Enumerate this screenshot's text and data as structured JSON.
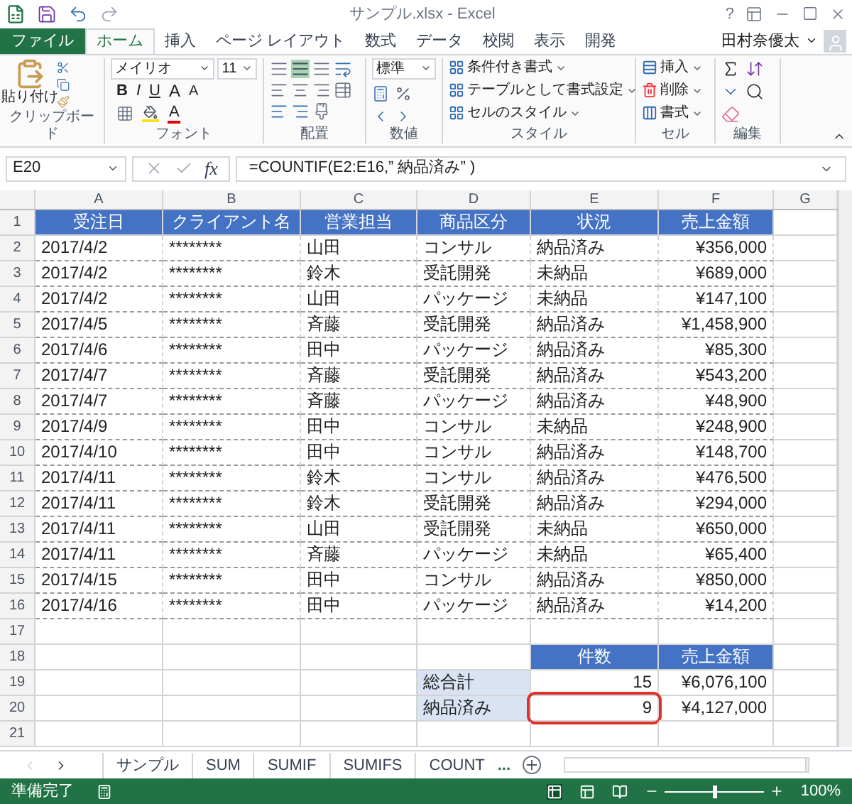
{
  "window": {
    "title": "サンプル.xlsx - Excel",
    "help": "?"
  },
  "tabs": [
    {
      "label": "ファイル",
      "kind": "file",
      "selected": false
    },
    {
      "label": "ホーム",
      "kind": "tab",
      "selected": true
    },
    {
      "label": "挿入",
      "kind": "tab",
      "selected": false
    },
    {
      "label": "ページ レイアウト",
      "kind": "tab",
      "selected": false
    },
    {
      "label": "数式",
      "kind": "tab",
      "selected": false
    },
    {
      "label": "データ",
      "kind": "tab",
      "selected": false
    },
    {
      "label": "校閲",
      "kind": "tab",
      "selected": false
    },
    {
      "label": "表示",
      "kind": "tab",
      "selected": false
    },
    {
      "label": "開発",
      "kind": "tab",
      "selected": false
    }
  ],
  "user": "田村奈優太",
  "ribbon": {
    "clipboard": {
      "paste": "貼り付け",
      "label": "クリップボード"
    },
    "font": {
      "name": "メイリオ",
      "size": "11",
      "format_buttons": [
        "B",
        "I",
        "U"
      ],
      "grow_shrink": [
        "A",
        "A"
      ],
      "font_color": "A",
      "label": "フォント"
    },
    "alignment": {
      "label": "配置"
    },
    "number": {
      "format": "標準",
      "label": "数値"
    },
    "styles": {
      "items": [
        "条件付き書式",
        "テーブルとして書式設定",
        "セルのスタイル"
      ],
      "label": "スタイル"
    },
    "cells": {
      "items": [
        "挿入",
        "削除",
        "書式"
      ],
      "label": "セル"
    },
    "editing": {
      "label": "編集"
    }
  },
  "formula_bar": {
    "name_box": "E20",
    "fx": "fx",
    "formula": "=COUNTIF(E2:E16,” 納品済み” )"
  },
  "sheet": {
    "column_headers": [
      "A",
      "B",
      "C",
      "D",
      "E",
      "F",
      "G"
    ],
    "row_numbers": [
      "1",
      "2",
      "3",
      "4",
      "5",
      "6",
      "7",
      "8",
      "9",
      "10",
      "11",
      "12",
      "13",
      "14",
      "15",
      "16",
      "17",
      "18",
      "19",
      "20",
      "21"
    ],
    "table": {
      "header": [
        "受注日",
        "クライアント名",
        "営業担当",
        "商品区分",
        "状況",
        "売上金額"
      ],
      "rows": [
        [
          "2017/4/2",
          "********",
          "山田",
          "コンサル",
          "納品済み",
          "¥356,000"
        ],
        [
          "2017/4/2",
          "********",
          "鈴木",
          "受託開発",
          "未納品",
          "¥689,000"
        ],
        [
          "2017/4/2",
          "********",
          "山田",
          "パッケージ",
          "未納品",
          "¥147,100"
        ],
        [
          "2017/4/5",
          "********",
          "斉藤",
          "受託開発",
          "納品済み",
          "¥1,458,900"
        ],
        [
          "2017/4/6",
          "********",
          "田中",
          "パッケージ",
          "納品済み",
          "¥85,300"
        ],
        [
          "2017/4/7",
          "********",
          "斉藤",
          "受託開発",
          "納品済み",
          "¥543,200"
        ],
        [
          "2017/4/7",
          "********",
          "斉藤",
          "パッケージ",
          "納品済み",
          "¥48,900"
        ],
        [
          "2017/4/9",
          "********",
          "田中",
          "コンサル",
          "未納品",
          "¥248,900"
        ],
        [
          "2017/4/10",
          "********",
          "田中",
          "コンサル",
          "納品済み",
          "¥148,700"
        ],
        [
          "2017/4/11",
          "********",
          "鈴木",
          "コンサル",
          "納品済み",
          "¥476,500"
        ],
        [
          "2017/4/11",
          "********",
          "鈴木",
          "受託開発",
          "納品済み",
          "¥294,000"
        ],
        [
          "2017/4/11",
          "********",
          "山田",
          "受託開発",
          "未納品",
          "¥650,000"
        ],
        [
          "2017/4/11",
          "********",
          "斉藤",
          "パッケージ",
          "未納品",
          "¥65,400"
        ],
        [
          "2017/4/15",
          "********",
          "田中",
          "コンサル",
          "納品済み",
          "¥850,000"
        ],
        [
          "2017/4/16",
          "********",
          "田中",
          "パッケージ",
          "納品済み",
          "¥14,200"
        ]
      ]
    },
    "summary": {
      "header": [
        "件数",
        "売上金額"
      ],
      "rows": [
        {
          "label": "総合計",
          "count": "15",
          "amount": "¥6,076,100",
          "selected": false
        },
        {
          "label": "納品済み",
          "count": "9",
          "amount": "¥4,127,000",
          "selected": true
        }
      ]
    }
  },
  "sheet_tabs": [
    {
      "label": "サンプル",
      "selected": false
    },
    {
      "label": "SUM",
      "selected": false
    },
    {
      "label": "SUMIF",
      "selected": false
    },
    {
      "label": "SUMIFS",
      "selected": false
    },
    {
      "label": "COUNT",
      "selected": false
    }
  ],
  "sheet_tabs_more": "...",
  "status": {
    "text": "準備完了",
    "zoom": "100%",
    "zoom_slider": {
      "level": 0.5
    }
  }
}
